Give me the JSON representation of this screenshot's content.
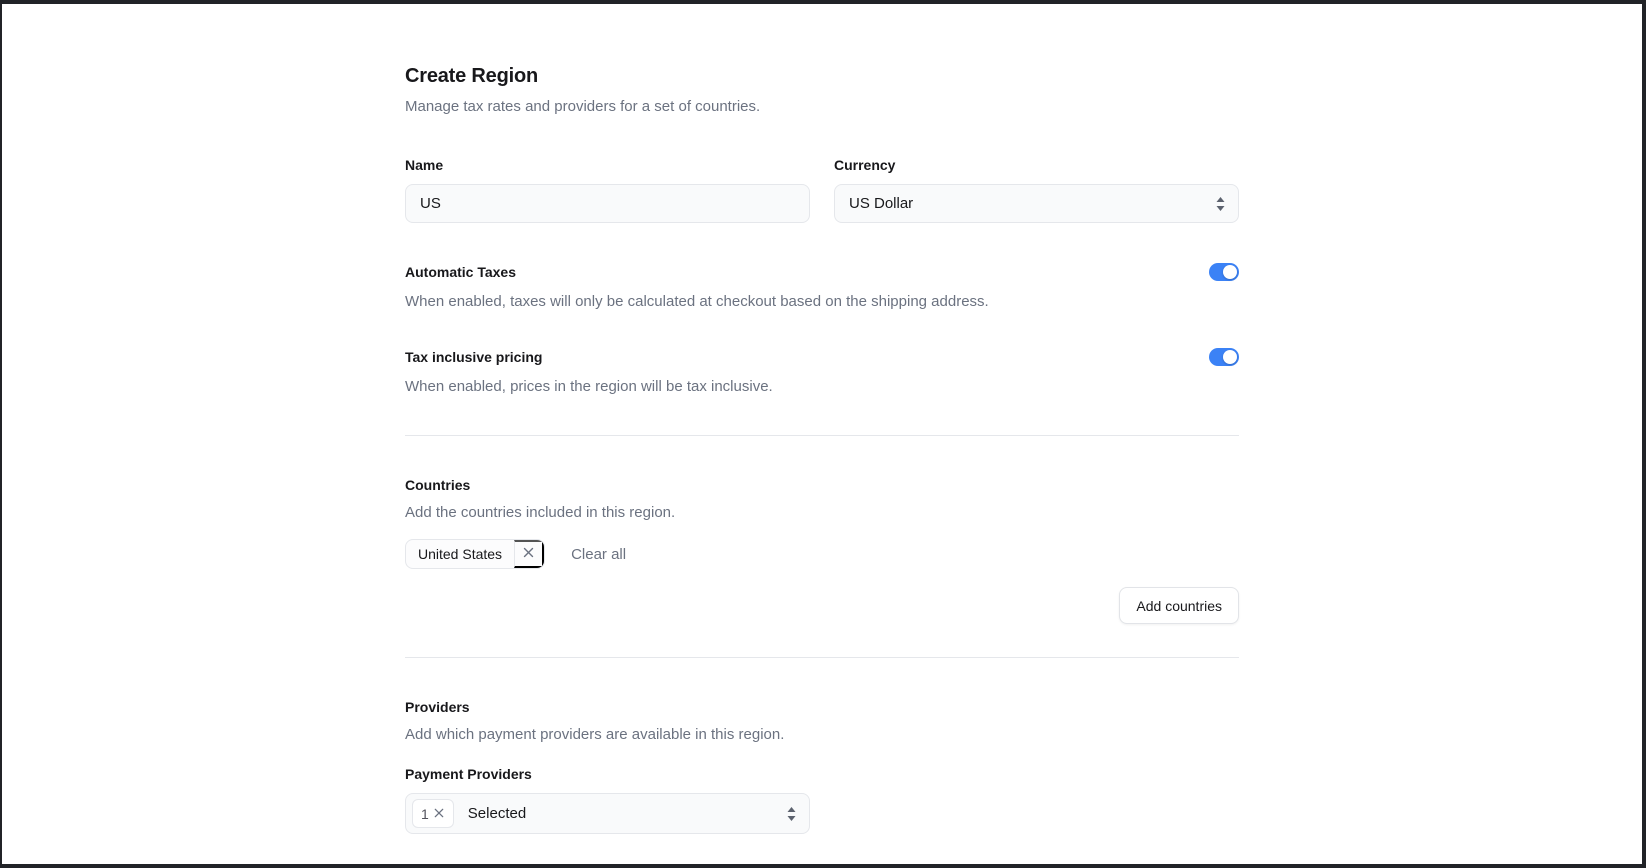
{
  "header": {
    "title": "Create Region",
    "subtitle": "Manage tax rates and providers for a set of countries."
  },
  "form": {
    "name": {
      "label": "Name",
      "value": "US"
    },
    "currency": {
      "label": "Currency",
      "value": "US Dollar"
    },
    "automatic_taxes": {
      "label": "Automatic Taxes",
      "description": "When enabled, taxes will only be calculated at checkout based on the shipping address.",
      "enabled": true
    },
    "tax_inclusive_pricing": {
      "label": "Tax inclusive pricing",
      "description": "When enabled, prices in the region will be tax inclusive.",
      "enabled": true
    }
  },
  "countries": {
    "heading": "Countries",
    "description": "Add the countries included in this region.",
    "selected": [
      {
        "name": "United States"
      }
    ],
    "clear_all_label": "Clear all",
    "add_button_label": "Add countries"
  },
  "providers": {
    "heading": "Providers",
    "description": "Add which payment providers are available in this region.",
    "payment_providers": {
      "label": "Payment Providers",
      "selected_count": "1",
      "selected_text": "Selected"
    }
  },
  "colors": {
    "toggle_on": "#3b82f6",
    "input_bg": "#f9fafb",
    "border": "#e5e7eb",
    "text_primary": "#18181b",
    "text_secondary": "#6b7280",
    "frame": "#212327"
  }
}
